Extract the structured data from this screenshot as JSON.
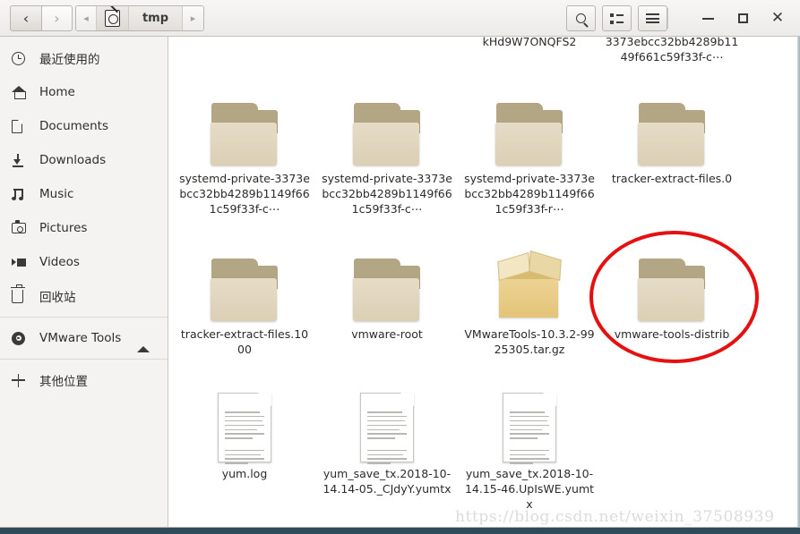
{
  "window": {
    "title": "tmp",
    "controls": {
      "minimize": "−",
      "maximize": "□",
      "close": "✕"
    }
  },
  "toolbar": {
    "back_label": "‹",
    "forward_label": "›",
    "breadcrumb_prev_label": "◂",
    "breadcrumb_next_label": "▸",
    "device_icon": "device-icon",
    "current_path": "tmp",
    "search_icon": "search-icon",
    "listview_icon": "list-view-icon",
    "menu_icon": "hamburger-icon"
  },
  "sidebar": {
    "items": [
      {
        "label": "最近使用的",
        "icon": "clock-icon"
      },
      {
        "label": "Home",
        "icon": "home-icon"
      },
      {
        "label": "Documents",
        "icon": "document-icon"
      },
      {
        "label": "Downloads",
        "icon": "download-icon"
      },
      {
        "label": "Music",
        "icon": "music-icon"
      },
      {
        "label": "Pictures",
        "icon": "camera-icon"
      },
      {
        "label": "Videos",
        "icon": "video-icon"
      },
      {
        "label": "回收站",
        "icon": "trash-icon"
      }
    ],
    "devices": [
      {
        "label": "VMware Tools",
        "icon": "disc-icon",
        "eject": "eject-icon"
      }
    ],
    "other": {
      "label": "其他位置",
      "icon": "plus-icon"
    }
  },
  "files": {
    "partial_top_row": [
      {
        "label": "kHd9W7ONQFS2",
        "type": "folder",
        "column": 2
      },
      {
        "label": "3373ebcc32bb4289b1149f661c59f33f-c⋯",
        "type": "folder",
        "column": 3
      }
    ],
    "rows": [
      [
        {
          "label": "systemd-private-3373ebcc32bb4289b1149f661c59f33f-c⋯",
          "type": "folder"
        },
        {
          "label": "systemd-private-3373ebcc32bb4289b1149f661c59f33f-c⋯",
          "type": "folder"
        },
        {
          "label": "systemd-private-3373ebcc32bb4289b1149f661c59f33f-r⋯",
          "type": "folder"
        },
        {
          "label": "tracker-extract-files.0",
          "type": "folder"
        }
      ],
      [
        {
          "label": "tracker-extract-files.1000",
          "type": "folder"
        },
        {
          "label": "vmware-root",
          "type": "folder"
        },
        {
          "label": "VMwareTools-10.3.2-9925305.tar.gz",
          "type": "archive"
        },
        {
          "label": "vmware-tools-distrib",
          "type": "folder",
          "annotated": true
        }
      ],
      [
        {
          "label": "yum.log",
          "type": "document"
        },
        {
          "label": "yum_save_tx.2018-10-14.14-05._CJdyY.yumtx",
          "type": "document"
        },
        {
          "label": "yum_save_tx.2018-10-14.15-46.UpIsWE.yumtx",
          "type": "document"
        }
      ]
    ]
  },
  "annotation": {
    "shape": "ellipse",
    "color": "#e51111",
    "target": "vmware-tools-distrib"
  },
  "watermark": {
    "text": "https://blog.csdn.net/weixin_37508939"
  }
}
